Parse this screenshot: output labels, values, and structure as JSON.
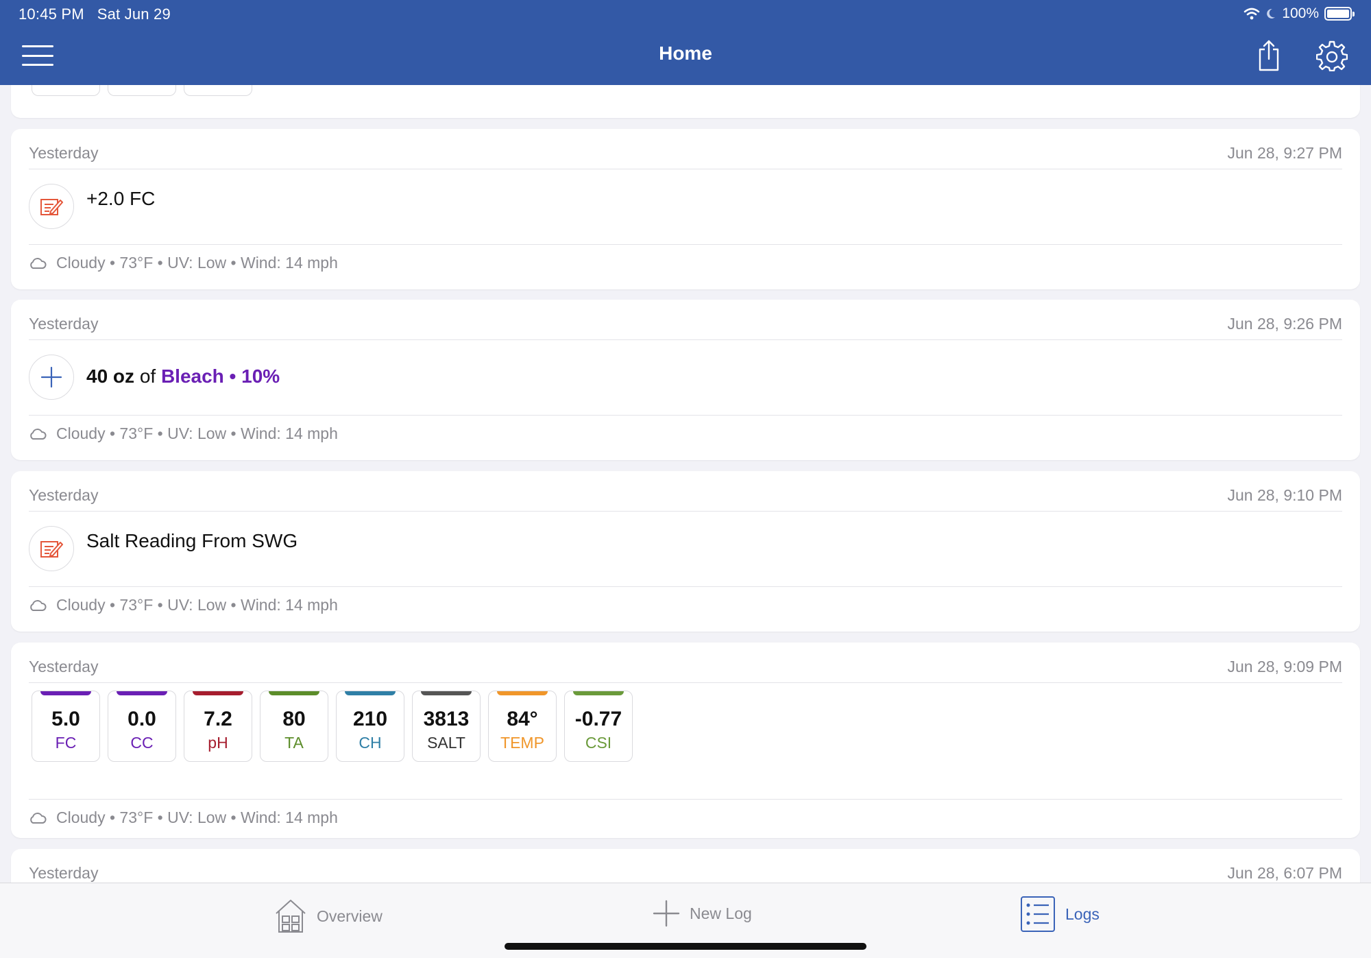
{
  "status": {
    "time": "10:45 PM",
    "date": "Sat Jun 29",
    "battery": "100%"
  },
  "nav": {
    "title": "Home"
  },
  "logs": [
    {
      "day": "Yesterday",
      "time": "Jun 28, 9:27 PM",
      "text": "+2.0 FC",
      "weather": "Cloudy • 73°F • UV: Low • Wind: 14 mph"
    },
    {
      "day": "Yesterday",
      "time": "Jun 28, 9:26 PM",
      "amount": "40 oz",
      "of": "of",
      "chemical": "Bleach • 10%",
      "weather": "Cloudy • 73°F • UV: Low • Wind: 14 mph"
    },
    {
      "day": "Yesterday",
      "time": "Jun 28, 9:10 PM",
      "text": "Salt Reading From SWG",
      "weather": "Cloudy • 73°F • UV: Low • Wind: 14 mph"
    },
    {
      "day": "Yesterday",
      "time": "Jun 28, 9:09 PM",
      "weather": "Cloudy • 73°F • UV: Low • Wind: 14 mph",
      "readings": [
        {
          "value": "5.0",
          "label": "FC",
          "color": "#6a1fb4"
        },
        {
          "value": "0.0",
          "label": "CC",
          "color": "#6a1fb4"
        },
        {
          "value": "7.2",
          "label": "pH",
          "color": "#a61d2e"
        },
        {
          "value": "80",
          "label": "TA",
          "color": "#5c8d2a"
        },
        {
          "value": "210",
          "label": "CH",
          "color": "#2f7fa6"
        },
        {
          "value": "3813",
          "label": "SALT",
          "color": "#555555"
        },
        {
          "value": "84°",
          "label": "TEMP",
          "color": "#f0962a"
        },
        {
          "value": "-0.77",
          "label": "CSI",
          "color": "#6a9a3a"
        }
      ]
    },
    {
      "day": "Yesterday",
      "time": "Jun 28, 6:07 PM"
    }
  ],
  "tabs": {
    "overview": "Overview",
    "new_log": "New Log",
    "logs": "Logs"
  }
}
